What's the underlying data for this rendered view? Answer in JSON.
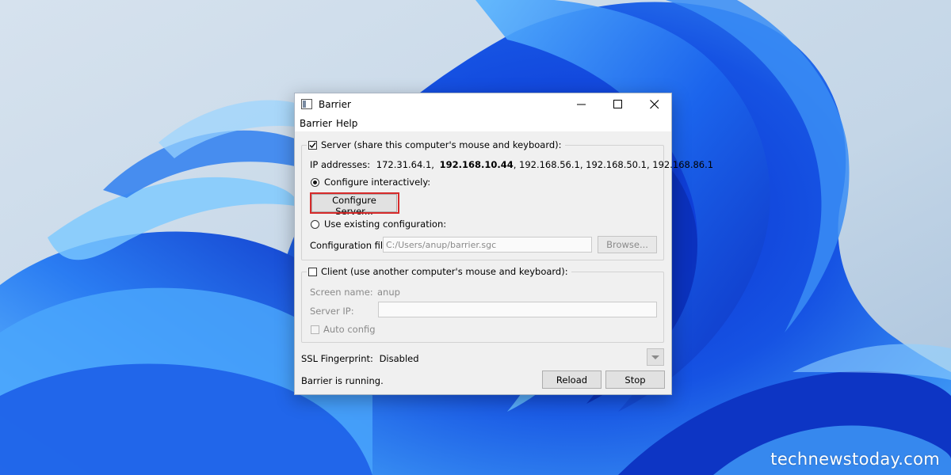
{
  "watermark": "technewstoday.com",
  "window": {
    "title": "Barrier",
    "menu": [
      "Barrier",
      "Help"
    ]
  },
  "server": {
    "label": "Server (share this computer's mouse and keyboard):",
    "checked": true,
    "ip_label": "IP addresses:",
    "ip_before": "172.31.64.1,",
    "ip_bold": "192.168.10.44",
    "ip_after": ", 192.168.56.1, 192.168.50.1, 192.168.86.1",
    "configure_interactively": "Configure interactively:",
    "configure_server_button": "Configure Server...",
    "use_existing": "Use existing configuration:",
    "config_file_label": "Configuration file:",
    "config_file_value": "C:/Users/anup/barrier.sgc",
    "browse_button": "Browse..."
  },
  "client": {
    "label": "Client (use another computer's mouse and keyboard):",
    "checked": false,
    "screen_name_label": "Screen name:",
    "screen_name_value": "anup",
    "server_ip_label": "Server IP:",
    "server_ip_value": "",
    "auto_config": "Auto config"
  },
  "ssl": {
    "label": "SSL Fingerprint:",
    "value": "Disabled"
  },
  "status": "Barrier is running.",
  "buttons": {
    "reload": "Reload",
    "stop": "Stop"
  },
  "colors": {
    "highlight": "#d62b2b",
    "wallpaper_blue": "#1f63e6"
  }
}
